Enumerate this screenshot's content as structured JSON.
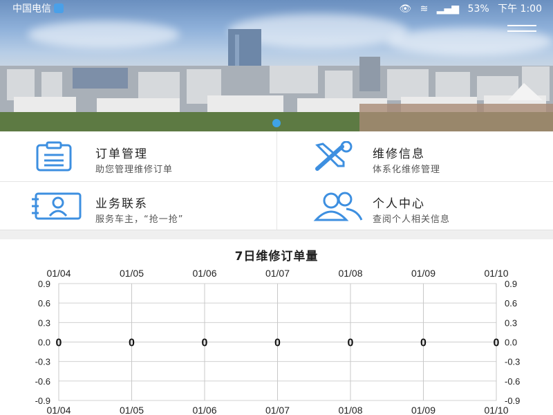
{
  "status_bar": {
    "carrier": "中国电信",
    "battery": "53%",
    "time": "下午 1:00"
  },
  "colors": {
    "accent": "#3d8fe0",
    "grid": "#cccccc",
    "pager_dot": "#3fa3e6"
  },
  "features": [
    {
      "title": "订单管理",
      "subtitle": "助您管理维修订单",
      "icon": "clipboard-icon"
    },
    {
      "title": "维修信息",
      "subtitle": "体系化维修管理",
      "icon": "wrench-screwdriver-icon"
    },
    {
      "title": "业务联系",
      "subtitle": "服务车主，“抢一抢”",
      "icon": "contact-card-icon"
    },
    {
      "title": "个人中心",
      "subtitle": "查阅个人相关信息",
      "icon": "users-icon"
    }
  ],
  "chart_data": {
    "type": "line",
    "title": "7日维修订单量",
    "categories": [
      "01/04",
      "01/05",
      "01/06",
      "01/07",
      "01/08",
      "01/09",
      "01/10"
    ],
    "series": [
      {
        "values": [
          0,
          0,
          0,
          0,
          0,
          0,
          0
        ]
      }
    ],
    "yticks": [
      "0.9",
      "0.6",
      "0.3",
      "0.0",
      "-0.3",
      "-0.6",
      "-0.9"
    ],
    "ylim": [
      -0.9,
      0.9
    ],
    "grid": true,
    "x_labels_top_and_bottom": true,
    "y_labels_left_and_right": true
  }
}
